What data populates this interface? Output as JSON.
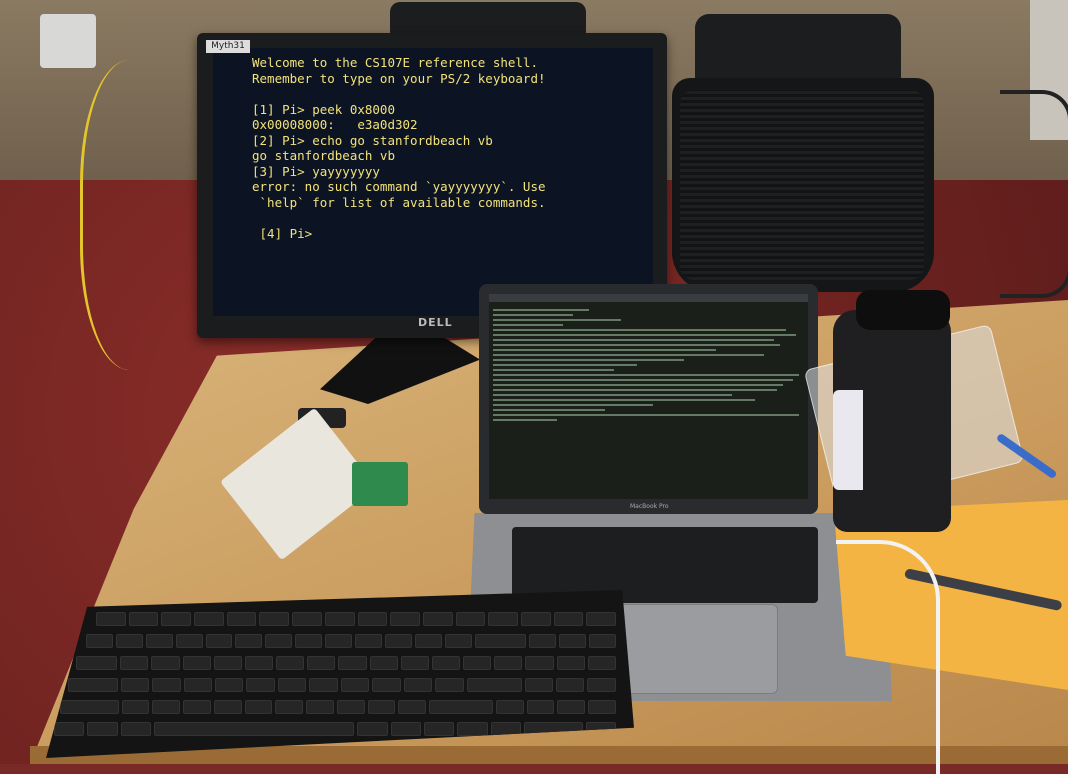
{
  "monitor": {
    "asset_tag": "Myth31",
    "brand": "DELL",
    "terminal_lines": [
      "Welcome to the CS107E reference shell.",
      "Remember to type on your PS/2 keyboard!",
      "",
      "[1] Pi> peek 0x8000",
      "0x00008000:   e3a0d302",
      "[2] Pi> echo go stanfordbeach vb",
      "go stanfordbeach vb",
      "[3] Pi> yayyyyyyy",
      "error: no such command `yayyyyyyy`. Use",
      " `help` for list of available commands.",
      "",
      " [4] Pi>"
    ]
  },
  "laptop": {
    "brand": "MacBook Pro"
  },
  "colors": {
    "terminal_background": "#0c1424",
    "terminal_text": "#f2e27a",
    "carpet": "#7a2a26",
    "desk": "#d2a86b",
    "paper": "#f4b443"
  }
}
